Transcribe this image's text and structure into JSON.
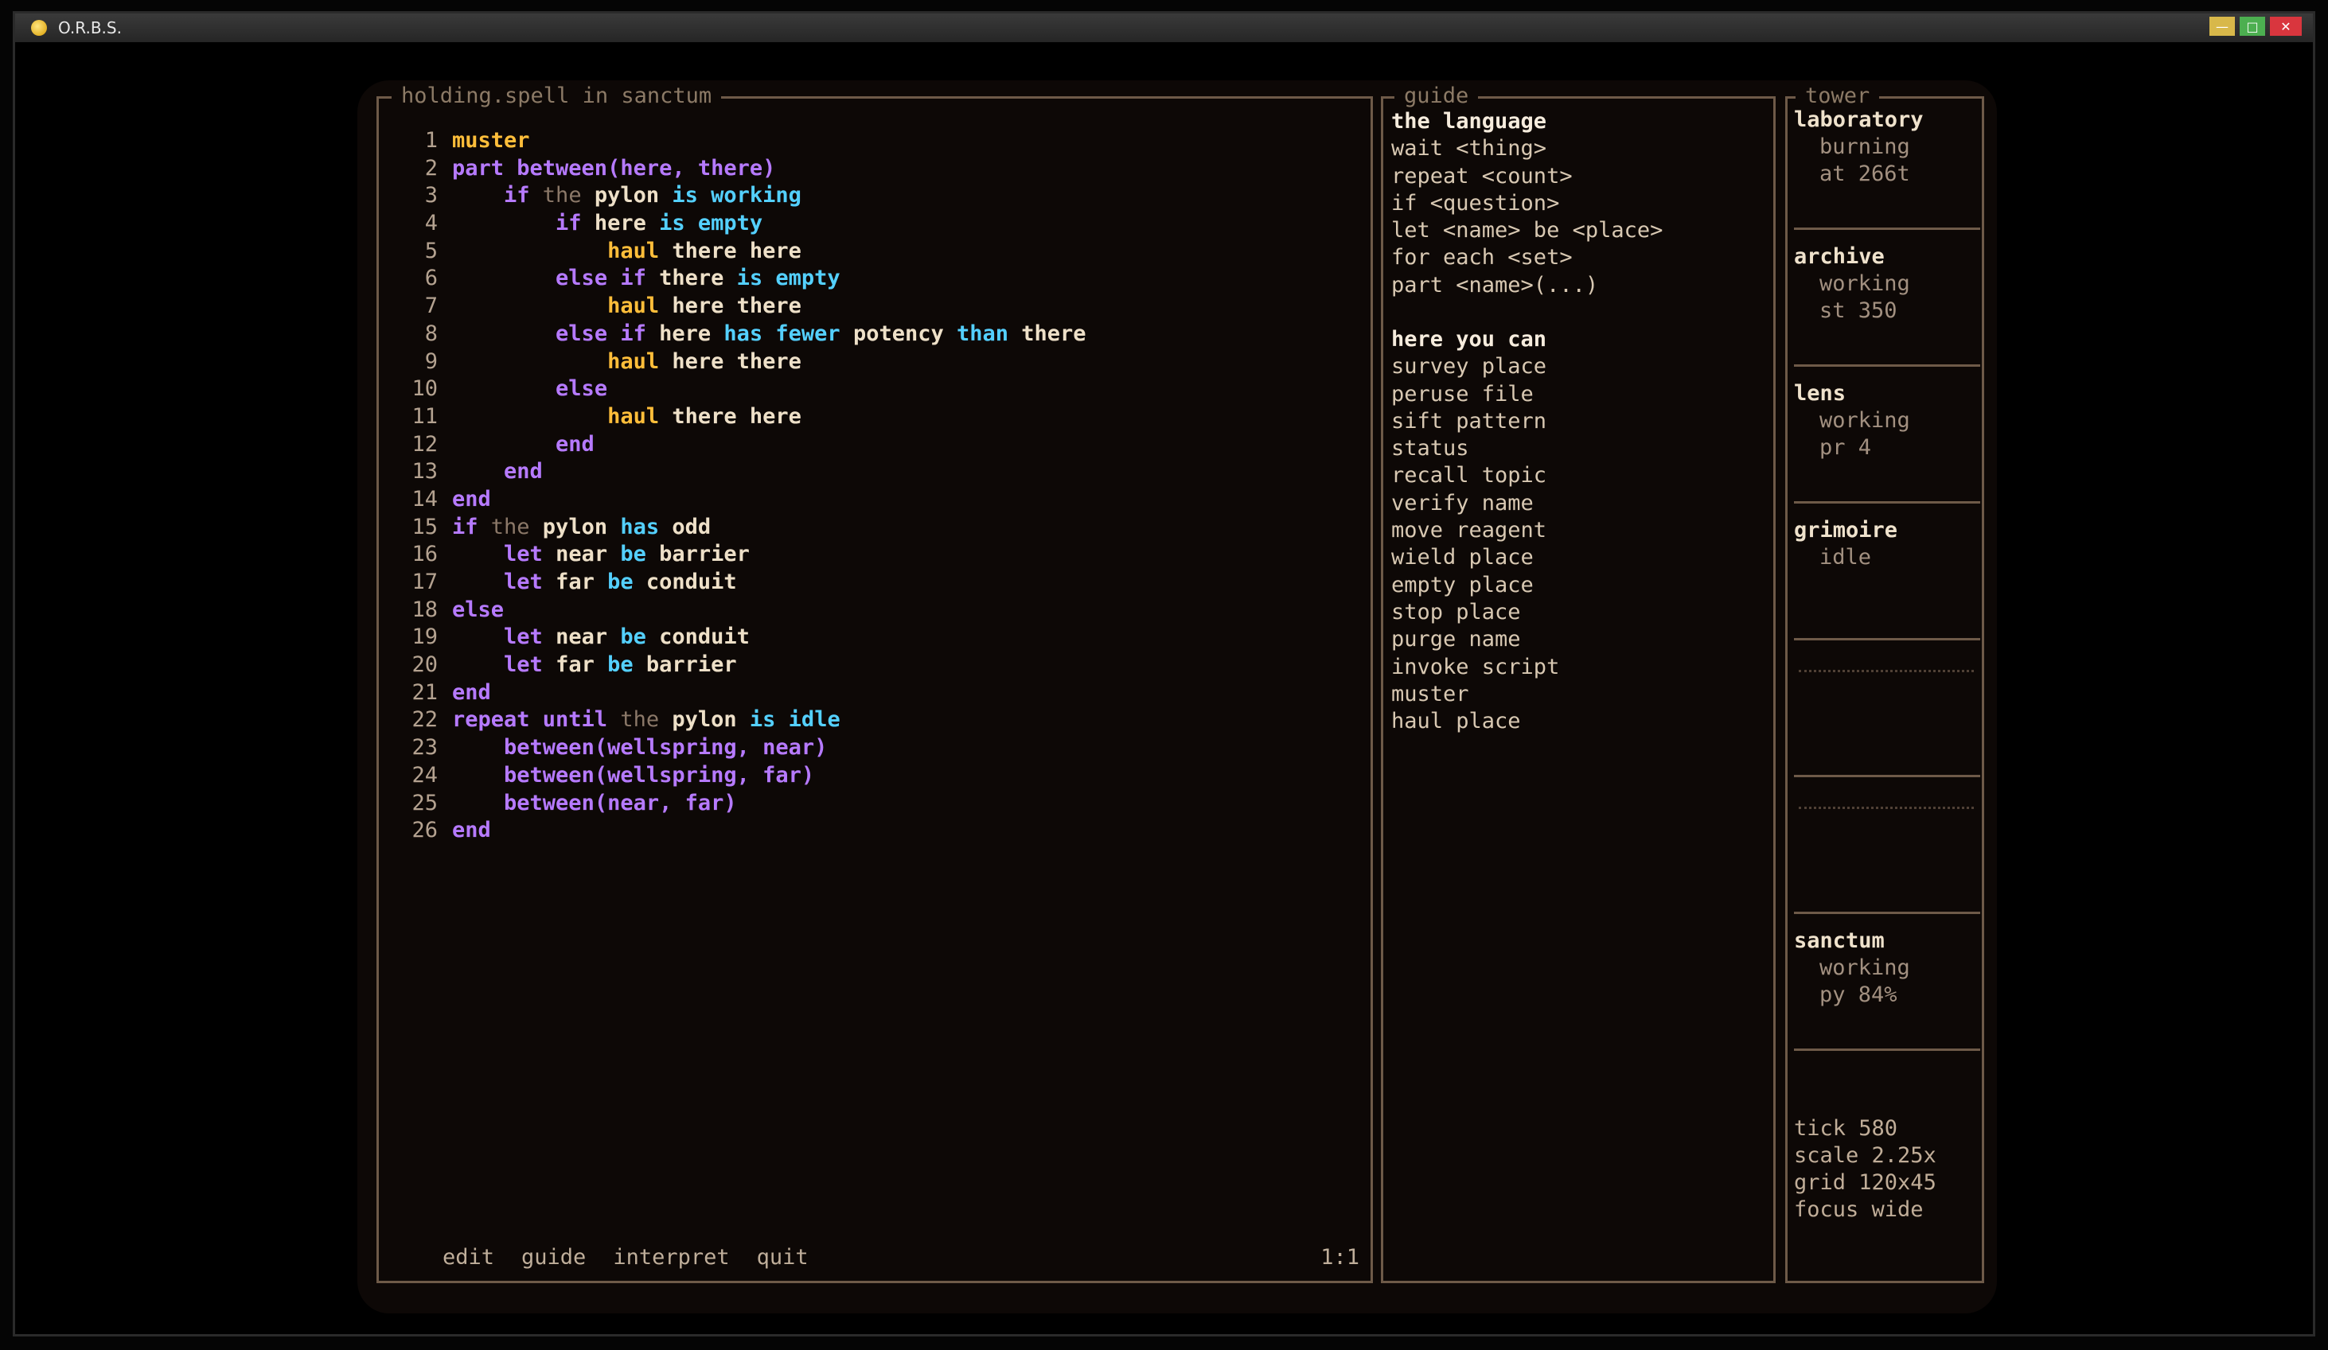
{
  "window": {
    "title": "O.R.B.S."
  },
  "editor": {
    "title": "holding.spell in sanctum",
    "lines": [
      {
        "n": "1",
        "tokens": [
          {
            "t": "muster",
            "c": "act"
          }
        ]
      },
      {
        "n": "2",
        "tokens": [
          {
            "t": "part between",
            "c": "kw"
          },
          {
            "t": "(here, there)",
            "c": "kw"
          }
        ]
      },
      {
        "n": "3",
        "tokens": [
          {
            "t": "    ",
            "c": "id"
          },
          {
            "t": "if",
            "c": "kw"
          },
          {
            "t": " the",
            "c": "fill"
          },
          {
            "t": " pylon",
            "c": "id"
          },
          {
            "t": " is working",
            "c": "cond"
          }
        ]
      },
      {
        "n": "4",
        "tokens": [
          {
            "t": "        ",
            "c": "id"
          },
          {
            "t": "if",
            "c": "kw"
          },
          {
            "t": " here",
            "c": "id"
          },
          {
            "t": " is empty",
            "c": "cond"
          }
        ]
      },
      {
        "n": "5",
        "tokens": [
          {
            "t": "            ",
            "c": "id"
          },
          {
            "t": "haul",
            "c": "act"
          },
          {
            "t": " there here",
            "c": "id"
          }
        ]
      },
      {
        "n": "6",
        "tokens": [
          {
            "t": "        ",
            "c": "id"
          },
          {
            "t": "else if",
            "c": "kw"
          },
          {
            "t": " there",
            "c": "id"
          },
          {
            "t": " is empty",
            "c": "cond"
          }
        ]
      },
      {
        "n": "7",
        "tokens": [
          {
            "t": "            ",
            "c": "id"
          },
          {
            "t": "haul",
            "c": "act"
          },
          {
            "t": " here there",
            "c": "id"
          }
        ]
      },
      {
        "n": "8",
        "tokens": [
          {
            "t": "        ",
            "c": "id"
          },
          {
            "t": "else if",
            "c": "kw"
          },
          {
            "t": " here",
            "c": "id"
          },
          {
            "t": " has fewer",
            "c": "cond"
          },
          {
            "t": " potency",
            "c": "id"
          },
          {
            "t": " than",
            "c": "cond"
          },
          {
            "t": " there",
            "c": "id"
          }
        ]
      },
      {
        "n": "9",
        "tokens": [
          {
            "t": "            ",
            "c": "id"
          },
          {
            "t": "haul",
            "c": "act"
          },
          {
            "t": " here there",
            "c": "id"
          }
        ]
      },
      {
        "n": "10",
        "tokens": [
          {
            "t": "        ",
            "c": "id"
          },
          {
            "t": "else",
            "c": "kw"
          }
        ]
      },
      {
        "n": "11",
        "tokens": [
          {
            "t": "            ",
            "c": "id"
          },
          {
            "t": "haul",
            "c": "act"
          },
          {
            "t": " there here",
            "c": "id"
          }
        ]
      },
      {
        "n": "12",
        "tokens": [
          {
            "t": "        ",
            "c": "id"
          },
          {
            "t": "end",
            "c": "kw"
          }
        ]
      },
      {
        "n": "13",
        "tokens": [
          {
            "t": "    ",
            "c": "id"
          },
          {
            "t": "end",
            "c": "kw"
          }
        ]
      },
      {
        "n": "14",
        "tokens": [
          {
            "t": "end",
            "c": "kw"
          }
        ]
      },
      {
        "n": "15",
        "tokens": [
          {
            "t": "if",
            "c": "kw"
          },
          {
            "t": " the",
            "c": "fill"
          },
          {
            "t": " pylon",
            "c": "id"
          },
          {
            "t": " has",
            "c": "cond"
          },
          {
            "t": " odd",
            "c": "id"
          }
        ]
      },
      {
        "n": "16",
        "tokens": [
          {
            "t": "    ",
            "c": "id"
          },
          {
            "t": "let",
            "c": "kw"
          },
          {
            "t": " near",
            "c": "id"
          },
          {
            "t": " be",
            "c": "cond"
          },
          {
            "t": " barrier",
            "c": "id"
          }
        ]
      },
      {
        "n": "17",
        "tokens": [
          {
            "t": "    ",
            "c": "id"
          },
          {
            "t": "let",
            "c": "kw"
          },
          {
            "t": " far",
            "c": "id"
          },
          {
            "t": " be",
            "c": "cond"
          },
          {
            "t": " conduit",
            "c": "id"
          }
        ]
      },
      {
        "n": "18",
        "tokens": [
          {
            "t": "else",
            "c": "kw"
          }
        ]
      },
      {
        "n": "19",
        "tokens": [
          {
            "t": "    ",
            "c": "id"
          },
          {
            "t": "let",
            "c": "kw"
          },
          {
            "t": " near",
            "c": "id"
          },
          {
            "t": " be",
            "c": "cond"
          },
          {
            "t": " conduit",
            "c": "id"
          }
        ]
      },
      {
        "n": "20",
        "tokens": [
          {
            "t": "    ",
            "c": "id"
          },
          {
            "t": "let",
            "c": "kw"
          },
          {
            "t": " far",
            "c": "id"
          },
          {
            "t": " be",
            "c": "cond"
          },
          {
            "t": " barrier",
            "c": "id"
          }
        ]
      },
      {
        "n": "21",
        "tokens": [
          {
            "t": "end",
            "c": "kw"
          }
        ]
      },
      {
        "n": "22",
        "tokens": [
          {
            "t": "repeat until",
            "c": "kw"
          },
          {
            "t": " the",
            "c": "fill"
          },
          {
            "t": " pylon",
            "c": "id"
          },
          {
            "t": " is idle",
            "c": "cond"
          }
        ]
      },
      {
        "n": "23",
        "tokens": [
          {
            "t": "    ",
            "c": "id"
          },
          {
            "t": "between(wellspring, near)",
            "c": "kw"
          }
        ]
      },
      {
        "n": "24",
        "tokens": [
          {
            "t": "    ",
            "c": "id"
          },
          {
            "t": "between(wellspring, far)",
            "c": "kw"
          }
        ]
      },
      {
        "n": "25",
        "tokens": [
          {
            "t": "    ",
            "c": "id"
          },
          {
            "t": "between(near, far)",
            "c": "kw"
          }
        ]
      },
      {
        "n": "26",
        "tokens": [
          {
            "t": "end",
            "c": "kw"
          }
        ]
      }
    ],
    "menu": [
      "edit",
      "guide",
      "interpret",
      "quit"
    ],
    "cursor": "1:1"
  },
  "guide": {
    "title": "guide",
    "language_heading": "the language",
    "language": [
      "wait <thing>",
      "repeat <count>",
      "if <question>",
      "let <name> be <place>",
      "for each <set>",
      "part <name>(...)"
    ],
    "actions_heading": "here you can",
    "actions": [
      "survey place",
      "peruse file",
      "sift pattern",
      "status",
      "recall topic",
      "verify name",
      "move reagent",
      "wield place",
      "empty place",
      "stop place",
      "purge name",
      "invoke script",
      "muster",
      "haul place"
    ]
  },
  "tower": {
    "title": "tower",
    "slots": [
      {
        "name": "laboratory",
        "state": "burning",
        "detail": "at 266t"
      },
      {
        "name": "archive",
        "state": "working",
        "detail": "st 350"
      },
      {
        "name": "lens",
        "state": "working",
        "detail": "pr 4"
      },
      {
        "name": "grimoire",
        "state": "idle",
        "detail": ""
      },
      {
        "name": "",
        "state": "",
        "detail": ""
      },
      {
        "name": "",
        "state": "",
        "detail": ""
      },
      {
        "name": "sanctum",
        "state": "working",
        "detail": "py 84%"
      }
    ],
    "stats": [
      {
        "label": "tick",
        "value": "580"
      },
      {
        "label": "scale",
        "value": "2.25x"
      },
      {
        "label": "grid",
        "value": "120x45"
      },
      {
        "label": "focus",
        "value": "wide"
      }
    ]
  }
}
